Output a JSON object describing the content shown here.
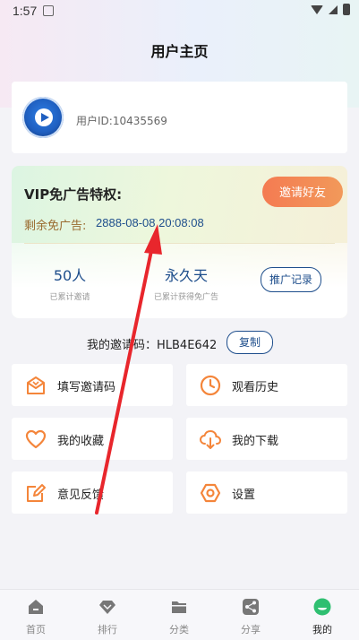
{
  "status_bar": {
    "time": "1:57"
  },
  "page_title": "用户主页",
  "user": {
    "id_label": "用户ID:10435569"
  },
  "vip": {
    "title": "VIP免广告特权:",
    "expire_label": "剩余免广告:",
    "expire_value": "2888-08-08 20:08:08",
    "invite_button": "邀请好友",
    "stats": [
      {
        "value": "50人",
        "label": "已累计邀请"
      },
      {
        "value": "永久天",
        "label": "已累计获得免广告"
      }
    ],
    "record_button": "推广记录"
  },
  "invite_code": {
    "text": "我的邀请码：HLB4E642",
    "copy_button": "复制"
  },
  "menu": [
    {
      "label": "填写邀请码",
      "icon": "envelope-icon"
    },
    {
      "label": "观看历史",
      "icon": "clock-icon"
    },
    {
      "label": "我的收藏",
      "icon": "heart-icon"
    },
    {
      "label": "我的下载",
      "icon": "cloud-download-icon"
    },
    {
      "label": "意见反馈",
      "icon": "edit-icon"
    },
    {
      "label": "设置",
      "icon": "settings-icon"
    }
  ],
  "tabs": [
    {
      "label": "首页",
      "icon": "home-icon"
    },
    {
      "label": "排行",
      "icon": "diamond-icon"
    },
    {
      "label": "分类",
      "icon": "folder-icon"
    },
    {
      "label": "分享",
      "icon": "share-icon"
    },
    {
      "label": "我的",
      "icon": "profile-icon",
      "active": true
    }
  ],
  "colors": {
    "accent": "#f47b52",
    "primary": "#1e4e8c",
    "active_tab": "#2fbf71",
    "arrow": "#e8262c"
  }
}
